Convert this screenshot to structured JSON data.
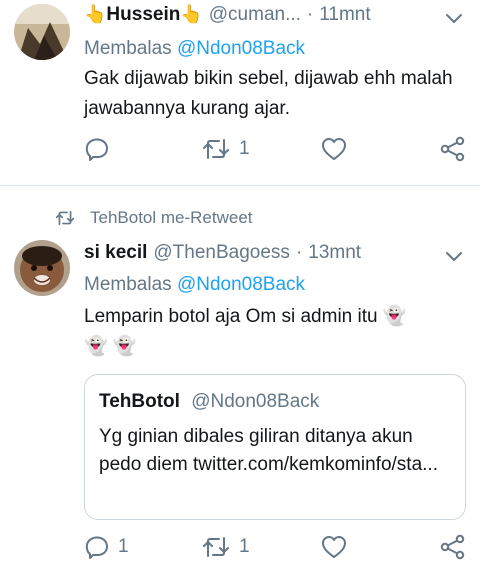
{
  "tweets": [
    {
      "name": "Hussein",
      "name_emoji_left": "👆",
      "name_emoji_right": "👆",
      "handle": "@cuman...",
      "separator": "·",
      "time": "11mnt",
      "reply_prefix": "Membalas",
      "reply_to": "@Ndon08Back",
      "text": "Gak dijawab bikin sebel, dijawab ehh malah jawabannya kurang ajar.",
      "actions": {
        "reply_count": "",
        "retweet_count": "1",
        "like_count": ""
      }
    },
    {
      "retweeted_by": "TehBotol me-Retweet",
      "name": "si kecil",
      "handle": "@ThenBagoess",
      "separator": "·",
      "time": "13mnt",
      "reply_prefix": "Membalas",
      "reply_to": "@Ndon08Back",
      "text_line1": "Lemparin botol aja Om si admin itu 👻",
      "text_line2": "👻 👻",
      "quote": {
        "name": "TehBotol",
        "handle": "@Ndon08Back",
        "text": "Yg ginian dibales giliran ditanya akun pedo diem twitter.com/kemkominfo/sta..."
      },
      "actions": {
        "reply_count": "1",
        "retweet_count": "1",
        "like_count": ""
      }
    }
  ],
  "colors": {
    "accent": "#1da1f2",
    "muted": "#657786",
    "text": "#14171a",
    "border": "#e1e8ed"
  },
  "icons": [
    "chevron-down-icon",
    "reply-icon",
    "retweet-icon",
    "like-icon",
    "share-icon"
  ]
}
